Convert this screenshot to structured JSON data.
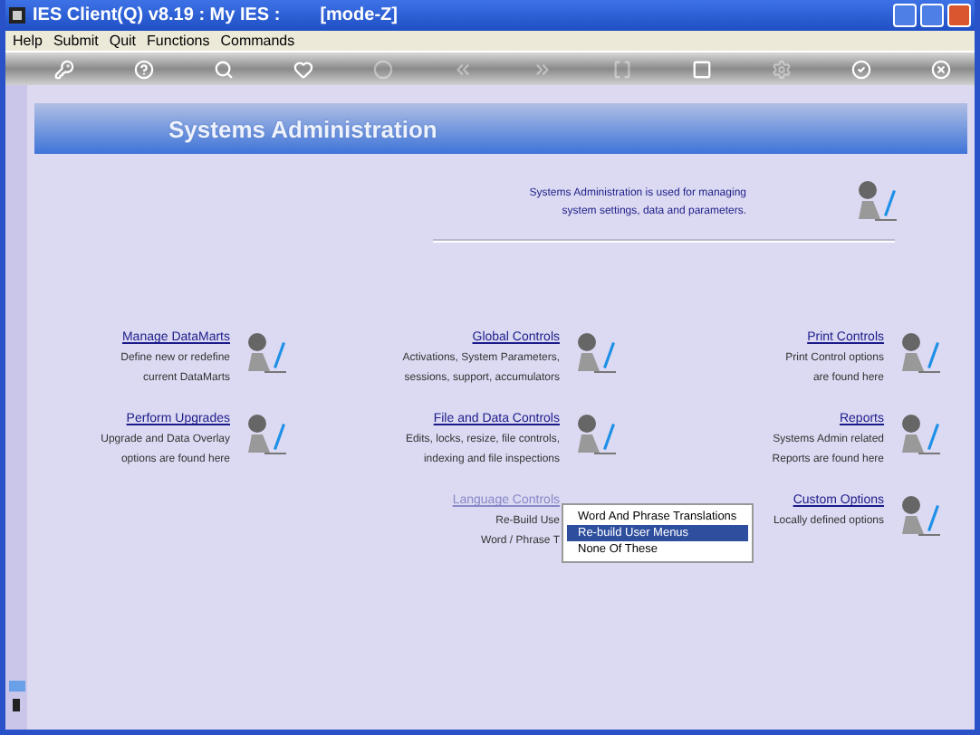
{
  "window": {
    "title": "IES Client(Q) v8.19 : My IES :",
    "mode": "[mode-Z]"
  },
  "menu": [
    "Help",
    "Submit",
    "Quit",
    "Functions",
    "Commands"
  ],
  "toolbar": [
    {
      "kind": "key",
      "disabled": false
    },
    {
      "kind": "help",
      "disabled": false
    },
    {
      "kind": "search",
      "disabled": false
    },
    {
      "kind": "spacer"
    },
    {
      "kind": "heart",
      "disabled": false
    },
    {
      "kind": "circle",
      "disabled": true
    },
    {
      "kind": "back",
      "disabled": true
    },
    {
      "kind": "forward",
      "disabled": true
    },
    {
      "kind": "bracket",
      "disabled": true
    },
    {
      "kind": "page",
      "disabled": false
    },
    {
      "kind": "spacer"
    },
    {
      "kind": "gear",
      "disabled": true
    },
    {
      "kind": "check",
      "disabled": false
    },
    {
      "kind": "close",
      "disabled": false
    }
  ],
  "banner": {
    "title": "Systems Administration"
  },
  "intro": [
    "Systems Administration is used for managing",
    "system settings, data and parameters."
  ],
  "cards": [
    {
      "title": "Manage DataMarts",
      "lines": [
        "Define new or redefine",
        "current DataMarts"
      ],
      "disabled": false
    },
    {
      "title": "Global Controls",
      "lines": [
        "Activations, System Parameters,",
        "sessions, support, accumulators"
      ],
      "disabled": false
    },
    {
      "title": "Print Controls",
      "lines": [
        "Print Control options",
        "are found here"
      ],
      "disabled": false
    },
    {
      "title": "Perform Upgrades",
      "lines": [
        "Upgrade and Data Overlay",
        "options are found here"
      ],
      "disabled": false
    },
    {
      "title": "File and Data Controls",
      "lines": [
        "Edits, locks, resize, file controls,",
        "indexing and file inspections"
      ],
      "disabled": false
    },
    {
      "title": "Reports",
      "lines": [
        "Systems Admin related",
        "Reports are found here"
      ],
      "disabled": false
    },
    {
      "title": "Language Controls",
      "lines": [
        "Re-Build Use",
        "Word / Phrase T"
      ],
      "disabled": true
    },
    {
      "title": "Custom Options",
      "lines": [
        "Locally defined options"
      ],
      "disabled": false
    }
  ],
  "popup": [
    {
      "label": "Word And Phrase Translations",
      "selected": false
    },
    {
      "label": "Re-build User Menus",
      "selected": true
    },
    {
      "label": "None Of These",
      "selected": false
    }
  ]
}
